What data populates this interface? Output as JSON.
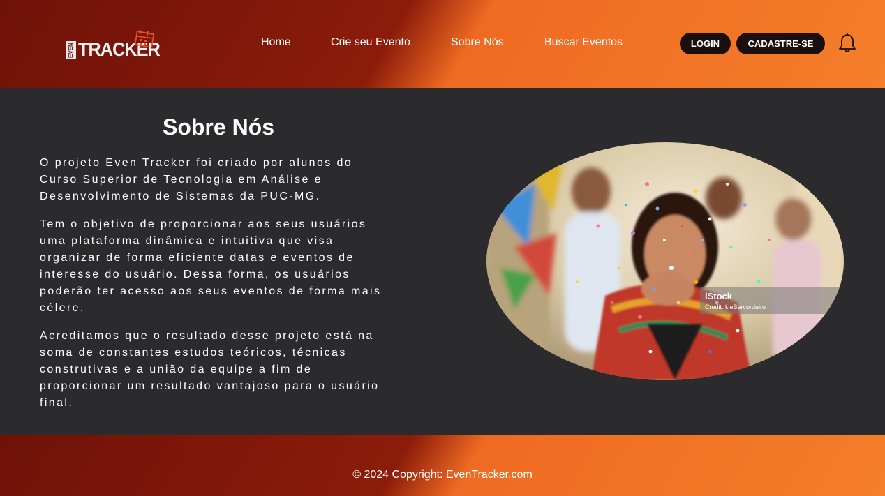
{
  "brand": {
    "logo_small": "EVEN",
    "logo_main": "TRACKER"
  },
  "nav": {
    "items": [
      {
        "label": "Home"
      },
      {
        "label": "Crie seu Evento"
      },
      {
        "label": "Sobre Nós"
      },
      {
        "label": "Buscar Eventos"
      }
    ]
  },
  "auth": {
    "login_label": "LOGIN",
    "signup_label": "CADASTRE-SE"
  },
  "notifications": {
    "icon": "bell-icon"
  },
  "about": {
    "title": "Sobre Nós",
    "paragraphs": [
      "O projeto Even Tracker foi criado por alunos do Curso Superior de Tecnologia em Análise e Desenvolvimento de Sistemas da PUC-MG.",
      "Tem o objetivo de proporcionar aos seus usuários uma plataforma dinâmica e intuitiva que visa organizar de forma eficiente datas e eventos de interesse do usuário. Dessa forma, os usuários poderão ter acesso aos seus eventos de forma mais célere.",
      "Acreditamos que o resultado desse projeto está na soma de constantes estudos teóricos, técnicas construtivas e a união da equipe a fim de proporcionar um resultado vantajoso para o usuário final."
    ],
    "image": {
      "watermark_brand": "iStock",
      "watermark_credit": "Credit: kleBercordeiro"
    }
  },
  "footer": {
    "copyright_prefix": "© 2024 Copyright: ",
    "link_text": "EvenTracker.com"
  },
  "colors": {
    "brand_dark_red": "#6e1208",
    "brand_orange": "#f47e2a",
    "content_bg": "#2b2a2c",
    "button_bg": "#1b0f0d"
  }
}
